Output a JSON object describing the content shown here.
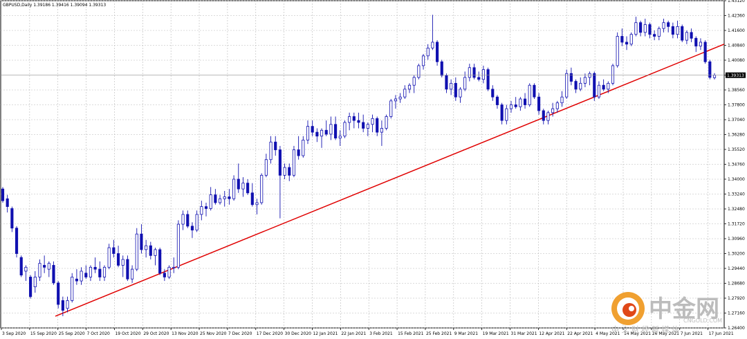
{
  "chart_data": {
    "type": "candlestick",
    "title": "GBPUSD,Daily  1.39186 1.39416 1.39094 1.39313",
    "symbol": "GBPUSD,Daily",
    "ohlc_header": [
      "1.39186",
      "1.39416",
      "1.39094",
      "1.39313"
    ],
    "current_price": 1.39313,
    "current_price_label": "1.39313",
    "ylim": [
      1.264,
      1.4312
    ],
    "y_ticks": [
      "1.43120",
      "1.42360",
      "1.41600",
      "1.40840",
      "1.40080",
      "1.39313",
      "1.38560",
      "1.37800",
      "1.37040",
      "1.36280",
      "1.35520",
      "1.34760",
      "1.34000",
      "1.33240",
      "1.32480",
      "1.31720",
      "1.30960",
      "1.30200",
      "1.29440",
      "1.28680",
      "1.27920",
      "1.27160",
      "1.26400"
    ],
    "x_ticks": [
      "3 Sep 2020",
      "15 Sep 2020",
      "25 Sep 2020",
      "7 Oct 2020",
      "19 Oct 2020",
      "29 Oct 2020",
      "13 Nov 2020",
      "25 Nov 2020",
      "7 Dec 2020",
      "17 Dec 2020",
      "30 Dec 2020",
      "12 Jan 2021",
      "22 Jan 2021",
      "3 Feb 2021",
      "15 Feb 2021",
      "25 Feb 2021",
      "9 Mar 2021",
      "19 Mar 2021",
      "31 Mar 2021",
      "12 Apr 2021",
      "22 Apr 2021",
      "4 May 2021",
      "14 May 2021",
      "26 May 2021",
      "7 Jun 2021",
      "17 Jun 2021"
    ],
    "bars": [
      [
        1.335,
        1.336,
        1.328,
        1.329
      ],
      [
        1.33,
        1.332,
        1.323,
        1.326
      ],
      [
        1.325,
        1.326,
        1.313,
        1.315
      ],
      [
        1.315,
        1.316,
        1.3,
        1.302
      ],
      [
        1.3,
        1.301,
        1.29,
        1.291
      ],
      [
        1.293,
        1.296,
        1.288,
        1.295
      ],
      [
        1.29,
        1.291,
        1.279,
        1.28
      ],
      [
        1.285,
        1.293,
        1.282,
        1.29
      ],
      [
        1.29,
        1.299,
        1.288,
        1.297
      ],
      [
        1.296,
        1.301,
        1.292,
        1.295
      ],
      [
        1.294,
        1.298,
        1.29,
        1.297
      ],
      [
        1.296,
        1.298,
        1.286,
        1.287
      ],
      [
        1.287,
        1.288,
        1.274,
        1.276
      ],
      [
        1.278,
        1.28,
        1.27,
        1.273
      ],
      [
        1.274,
        1.28,
        1.272,
        1.278
      ],
      [
        1.278,
        1.292,
        1.277,
        1.29
      ],
      [
        1.289,
        1.294,
        1.286,
        1.288
      ],
      [
        1.288,
        1.295,
        1.286,
        1.293
      ],
      [
        1.292,
        1.296,
        1.289,
        1.29
      ],
      [
        1.29,
        1.296,
        1.288,
        1.295
      ],
      [
        1.295,
        1.3,
        1.292,
        1.294
      ],
      [
        1.294,
        1.298,
        1.288,
        1.29
      ],
      [
        1.29,
        1.296,
        1.288,
        1.295
      ],
      [
        1.295,
        1.307,
        1.294,
        1.305
      ],
      [
        1.305,
        1.309,
        1.3,
        1.302
      ],
      [
        1.302,
        1.306,
        1.295,
        1.296
      ],
      [
        1.296,
        1.301,
        1.29,
        1.299
      ],
      [
        1.299,
        1.301,
        1.288,
        1.289
      ],
      [
        1.289,
        1.296,
        1.287,
        1.294
      ],
      [
        1.294,
        1.315,
        1.293,
        1.312
      ],
      [
        1.312,
        1.317,
        1.302,
        1.304
      ],
      [
        1.304,
        1.309,
        1.3,
        1.306
      ],
      [
        1.306,
        1.308,
        1.299,
        1.301
      ],
      [
        1.301,
        1.305,
        1.296,
        1.304
      ],
      [
        1.304,
        1.305,
        1.291,
        1.292
      ],
      [
        1.292,
        1.294,
        1.288,
        1.29
      ],
      [
        1.29,
        1.296,
        1.289,
        1.295
      ],
      [
        1.295,
        1.3,
        1.292,
        1.295
      ],
      [
        1.295,
        1.319,
        1.294,
        1.317
      ],
      [
        1.317,
        1.324,
        1.314,
        1.322
      ],
      [
        1.322,
        1.324,
        1.315,
        1.316
      ],
      [
        1.316,
        1.318,
        1.31,
        1.314
      ],
      [
        1.314,
        1.324,
        1.313,
        1.322
      ],
      [
        1.322,
        1.329,
        1.319,
        1.326
      ],
      [
        1.326,
        1.328,
        1.321,
        1.325
      ],
      [
        1.325,
        1.336,
        1.324,
        1.332
      ],
      [
        1.332,
        1.335,
        1.327,
        1.328
      ],
      [
        1.328,
        1.332,
        1.327,
        1.33
      ],
      [
        1.33,
        1.334,
        1.326,
        1.331
      ],
      [
        1.331,
        1.335,
        1.327,
        1.33
      ],
      [
        1.33,
        1.342,
        1.329,
        1.34
      ],
      [
        1.34,
        1.348,
        1.333,
        1.335
      ],
      [
        1.335,
        1.341,
        1.331,
        1.338
      ],
      [
        1.338,
        1.34,
        1.332,
        1.333
      ],
      [
        1.333,
        1.338,
        1.326,
        1.327
      ],
      [
        1.327,
        1.33,
        1.322,
        1.328
      ],
      [
        1.328,
        1.343,
        1.327,
        1.342
      ],
      [
        1.342,
        1.353,
        1.341,
        1.35
      ],
      [
        1.35,
        1.362,
        1.348,
        1.359
      ],
      [
        1.359,
        1.362,
        1.352,
        1.355
      ],
      [
        1.355,
        1.357,
        1.32,
        1.342
      ],
      [
        1.342,
        1.348,
        1.34,
        1.346
      ],
      [
        1.346,
        1.348,
        1.339,
        1.342
      ],
      [
        1.342,
        1.357,
        1.341,
        1.355
      ],
      [
        1.355,
        1.362,
        1.35,
        1.352
      ],
      [
        1.352,
        1.362,
        1.351,
        1.36
      ],
      [
        1.36,
        1.37,
        1.358,
        1.367
      ],
      [
        1.367,
        1.37,
        1.362,
        1.364
      ],
      [
        1.364,
        1.366,
        1.359,
        1.362
      ],
      [
        1.362,
        1.366,
        1.356,
        1.365
      ],
      [
        1.365,
        1.37,
        1.362,
        1.363
      ],
      [
        1.363,
        1.372,
        1.36,
        1.368
      ],
      [
        1.368,
        1.372,
        1.36,
        1.361
      ],
      [
        1.361,
        1.365,
        1.357,
        1.362
      ],
      [
        1.362,
        1.37,
        1.361,
        1.369
      ],
      [
        1.369,
        1.374,
        1.365,
        1.372
      ],
      [
        1.372,
        1.374,
        1.366,
        1.37
      ],
      [
        1.37,
        1.374,
        1.366,
        1.369
      ],
      [
        1.369,
        1.373,
        1.364,
        1.366
      ],
      [
        1.366,
        1.369,
        1.362,
        1.368
      ],
      [
        1.368,
        1.373,
        1.364,
        1.371
      ],
      [
        1.371,
        1.372,
        1.362,
        1.364
      ],
      [
        1.364,
        1.37,
        1.357,
        1.366
      ],
      [
        1.366,
        1.373,
        1.365,
        1.372
      ],
      [
        1.372,
        1.381,
        1.371,
        1.38
      ],
      [
        1.38,
        1.383,
        1.376,
        1.381
      ],
      [
        1.381,
        1.384,
        1.379,
        1.382
      ],
      [
        1.382,
        1.388,
        1.381,
        1.386
      ],
      [
        1.386,
        1.389,
        1.384,
        1.388
      ],
      [
        1.388,
        1.393,
        1.384,
        1.392
      ],
      [
        1.392,
        1.399,
        1.391,
        1.398
      ],
      [
        1.398,
        1.404,
        1.396,
        1.403
      ],
      [
        1.403,
        1.409,
        1.401,
        1.407
      ],
      [
        1.407,
        1.424,
        1.406,
        1.41
      ],
      [
        1.41,
        1.411,
        1.398,
        1.4
      ],
      [
        1.4,
        1.401,
        1.392,
        1.393
      ],
      [
        1.393,
        1.394,
        1.384,
        1.386
      ],
      [
        1.386,
        1.391,
        1.383,
        1.389
      ],
      [
        1.389,
        1.392,
        1.38,
        1.382
      ],
      [
        1.382,
        1.387,
        1.379,
        1.386
      ],
      [
        1.386,
        1.395,
        1.385,
        1.392
      ],
      [
        1.392,
        1.399,
        1.39,
        1.397
      ],
      [
        1.397,
        1.399,
        1.391,
        1.392
      ],
      [
        1.392,
        1.395,
        1.39,
        1.391
      ],
      [
        1.391,
        1.398,
        1.389,
        1.396
      ],
      [
        1.396,
        1.397,
        1.385,
        1.386
      ],
      [
        1.386,
        1.388,
        1.38,
        1.382
      ],
      [
        1.382,
        1.383,
        1.376,
        1.378
      ],
      [
        1.378,
        1.379,
        1.368,
        1.37
      ],
      [
        1.37,
        1.378,
        1.368,
        1.376
      ],
      [
        1.376,
        1.38,
        1.374,
        1.378
      ],
      [
        1.378,
        1.382,
        1.376,
        1.377
      ],
      [
        1.377,
        1.382,
        1.375,
        1.381
      ],
      [
        1.381,
        1.384,
        1.376,
        1.378
      ],
      [
        1.378,
        1.389,
        1.377,
        1.388
      ],
      [
        1.388,
        1.389,
        1.381,
        1.382
      ],
      [
        1.382,
        1.384,
        1.373,
        1.375
      ],
      [
        1.375,
        1.376,
        1.368,
        1.37
      ],
      [
        1.37,
        1.375,
        1.368,
        1.374
      ],
      [
        1.374,
        1.379,
        1.372,
        1.376
      ],
      [
        1.376,
        1.38,
        1.374,
        1.379
      ],
      [
        1.379,
        1.385,
        1.377,
        1.382
      ],
      [
        1.382,
        1.396,
        1.381,
        1.394
      ],
      [
        1.394,
        1.397,
        1.388,
        1.39
      ],
      [
        1.39,
        1.391,
        1.384,
        1.386
      ],
      [
        1.386,
        1.392,
        1.385,
        1.389
      ],
      [
        1.389,
        1.394,
        1.387,
        1.392
      ],
      [
        1.392,
        1.395,
        1.388,
        1.394
      ],
      [
        1.394,
        1.395,
        1.38,
        1.382
      ],
      [
        1.382,
        1.39,
        1.381,
        1.388
      ],
      [
        1.388,
        1.391,
        1.385,
        1.386
      ],
      [
        1.386,
        1.39,
        1.384,
        1.389
      ],
      [
        1.389,
        1.399,
        1.388,
        1.398
      ],
      [
        1.398,
        1.415,
        1.397,
        1.413
      ],
      [
        1.413,
        1.417,
        1.408,
        1.41
      ],
      [
        1.41,
        1.413,
        1.406,
        1.409
      ],
      [
        1.409,
        1.415,
        1.408,
        1.414
      ],
      [
        1.414,
        1.423,
        1.413,
        1.42
      ],
      [
        1.42,
        1.421,
        1.413,
        1.415
      ],
      [
        1.415,
        1.422,
        1.413,
        1.419
      ],
      [
        1.419,
        1.42,
        1.412,
        1.414
      ],
      [
        1.414,
        1.416,
        1.411,
        1.413
      ],
      [
        1.413,
        1.418,
        1.411,
        1.417
      ],
      [
        1.417,
        1.422,
        1.415,
        1.42
      ],
      [
        1.42,
        1.421,
        1.415,
        1.418
      ],
      [
        1.418,
        1.42,
        1.412,
        1.414
      ],
      [
        1.414,
        1.421,
        1.412,
        1.418
      ],
      [
        1.418,
        1.419,
        1.41,
        1.411
      ],
      [
        1.411,
        1.416,
        1.409,
        1.415
      ],
      [
        1.415,
        1.417,
        1.41,
        1.412
      ],
      [
        1.412,
        1.413,
        1.405,
        1.408
      ],
      [
        1.408,
        1.412,
        1.406,
        1.41
      ],
      [
        1.41,
        1.411,
        1.399,
        1.4
      ],
      [
        1.4,
        1.401,
        1.391,
        1.392
      ],
      [
        1.39186,
        1.39416,
        1.39094,
        1.39313
      ]
    ],
    "trendline": {
      "start": {
        "date": "23 Sep 2020",
        "value": 1.27
      },
      "end": {
        "date": "18 Jun 2021",
        "value": 1.409
      },
      "color": "#e00000"
    },
    "candle_color": "#1010b0",
    "grid": true,
    "grid_color": "#b8b8b8"
  },
  "watermark": {
    "brand_cn": "中金网",
    "brand_en": "CNGOLD.COM",
    "slogan": "中 文 财 经 新 媒 体",
    "colors": {
      "outer": "#f0a030",
      "inner": "#e04818",
      "text": "#bcbcbc"
    }
  }
}
